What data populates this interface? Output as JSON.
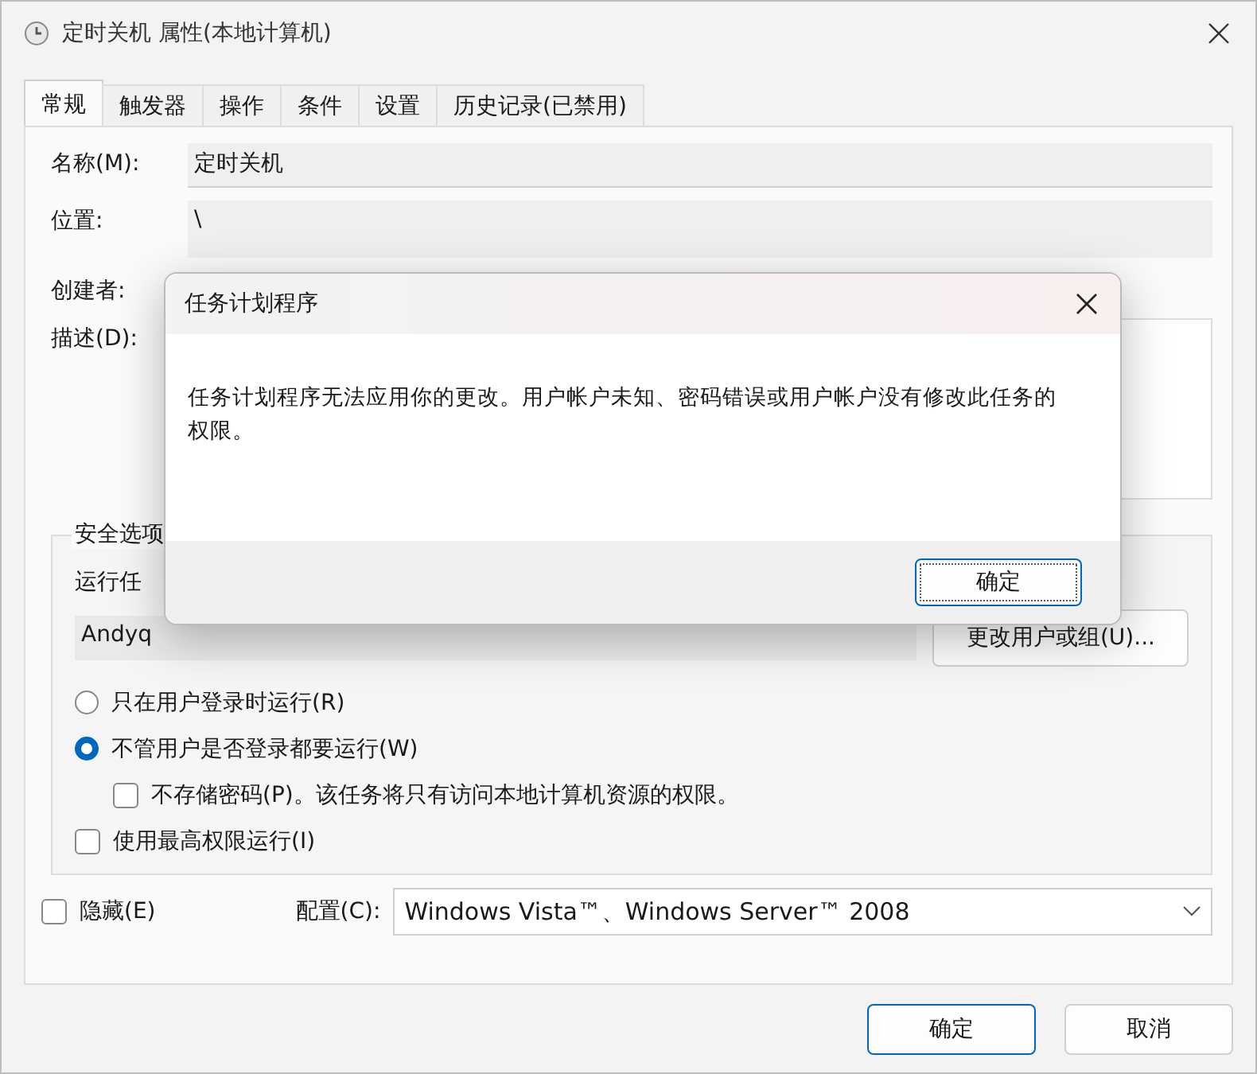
{
  "window": {
    "title": "定时关机 属性(本地计算机)"
  },
  "tabs": [
    {
      "label": "常规",
      "selected": true
    },
    {
      "label": "触发器",
      "selected": false
    },
    {
      "label": "操作",
      "selected": false
    },
    {
      "label": "条件",
      "selected": false
    },
    {
      "label": "设置",
      "selected": false
    },
    {
      "label": "历史记录(已禁用)",
      "selected": false
    }
  ],
  "general": {
    "name_label": "名称(M):",
    "name_value": "定时关机",
    "location_label": "位置:",
    "location_value": "\\",
    "author_label": "创建者:",
    "description_label": "描述(D):"
  },
  "security": {
    "legend": "安全选项",
    "run_as_label": "运行任",
    "user": "Andyq",
    "change_button": "更改用户或组(U)...",
    "options": [
      {
        "kind": "radio",
        "label": "只在用户登录时运行(R)",
        "selected": false
      },
      {
        "kind": "radio",
        "label": "不管用户是否登录都要运行(W)",
        "selected": true,
        "children": [
          {
            "kind": "checkbox",
            "label": "不存储密码(P)。该任务将只有访问本地计算机资源的权限。",
            "checked": false
          }
        ]
      },
      {
        "kind": "checkbox",
        "label": "使用最高权限运行(I)",
        "checked": false
      }
    ]
  },
  "hidden": {
    "label": "隐藏(E)",
    "checked": false
  },
  "configure": {
    "label": "配置(C):",
    "value": "Windows Vista™、Windows Server™ 2008"
  },
  "buttons": [
    {
      "label": "确定",
      "default": true
    },
    {
      "label": "取消",
      "default": false
    }
  ],
  "dialog": {
    "title": "任务计划程序",
    "message": "任务计划程序无法应用你的更改。用户帐户未知、密码错误或用户帐户没有修改此任务的权限。",
    "ok_button": "确定"
  }
}
